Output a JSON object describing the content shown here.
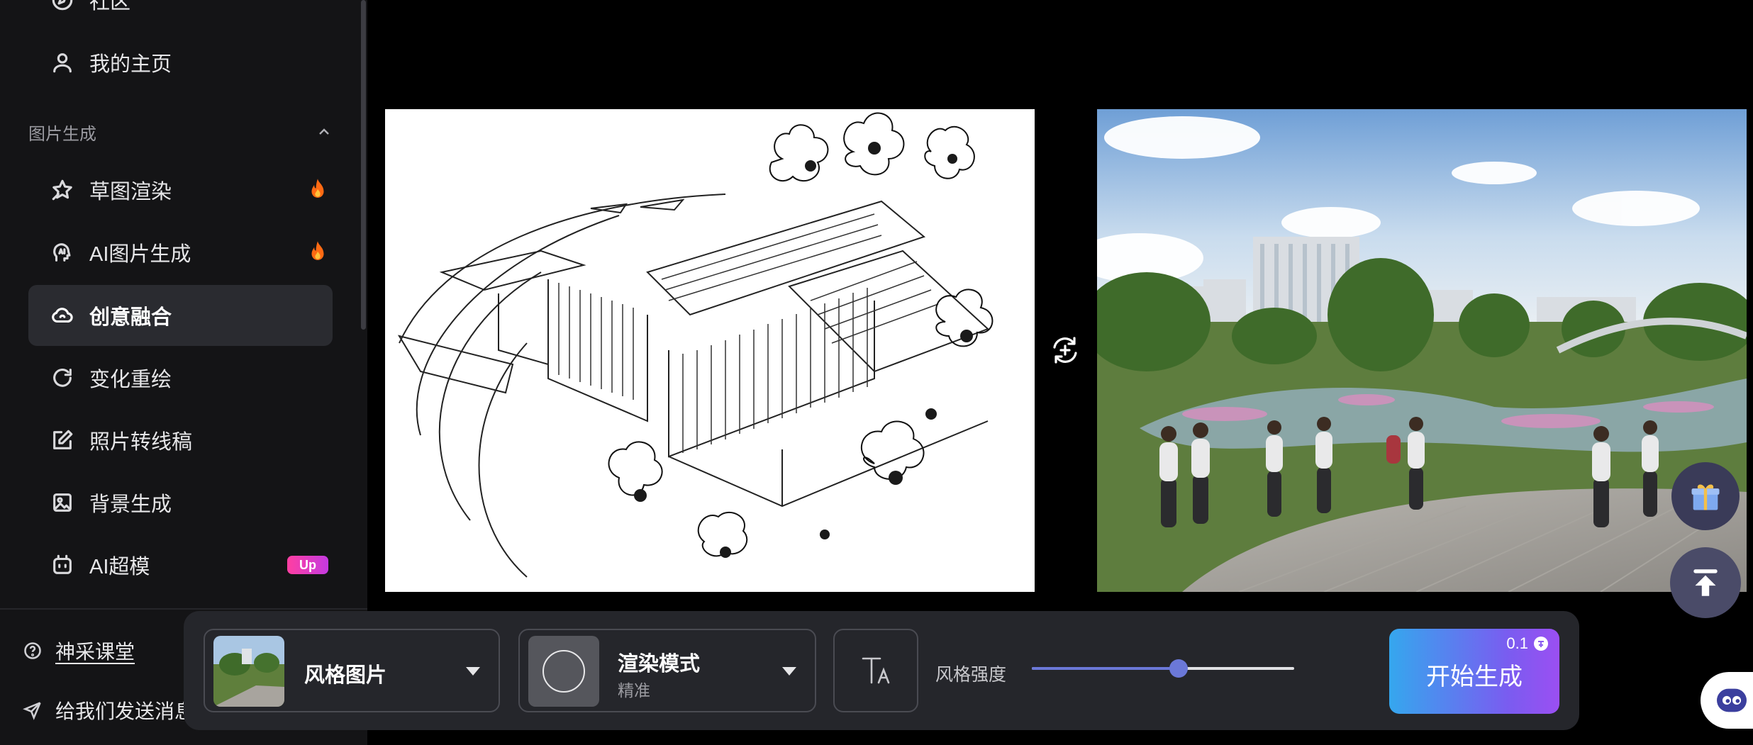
{
  "sidebar": {
    "top_items": [
      {
        "label": "社区",
        "icon": "compass-icon"
      },
      {
        "label": "我的主页",
        "icon": "user-icon"
      }
    ],
    "section_title": "图片生成",
    "items": [
      {
        "label": "草图渲染",
        "icon": "sketch-star-icon",
        "badge": "fire"
      },
      {
        "label": "AI图片生成",
        "icon": "ai-brain-icon",
        "badge": "fire"
      },
      {
        "label": "创意融合",
        "icon": "cloud-blend-icon",
        "active": true
      },
      {
        "label": "变化重绘",
        "icon": "refresh-icon"
      },
      {
        "label": "照片转线稿",
        "icon": "edit-square-icon"
      },
      {
        "label": "背景生成",
        "icon": "image-icon"
      },
      {
        "label": "AI超模",
        "icon": "robot-icon",
        "badge": "Up"
      }
    ],
    "footer": {
      "course": "神采课堂",
      "feedback": "给我们发送消息"
    }
  },
  "canvas": {
    "swap_icon": "swap-add-icon",
    "left_image": "architectural-sketch",
    "right_image": "rendered-park-scene"
  },
  "toolbar": {
    "style_label": "风格图片",
    "mode_label": "渲染模式",
    "mode_value": "精准",
    "text_icon": "text-size-icon",
    "strength_label": "风格强度",
    "strength_value": 0.56,
    "generate_label": "开始生成",
    "generate_cost": "0.1"
  },
  "colors": {
    "accent": "#6b78d8",
    "fire": "#ff7a1a",
    "badge_gradient_start": "#ff3fa1",
    "badge_gradient_end": "#c43ae0",
    "button_gradient_start": "#35a7ee",
    "button_gradient_end": "#9b4ff2"
  }
}
